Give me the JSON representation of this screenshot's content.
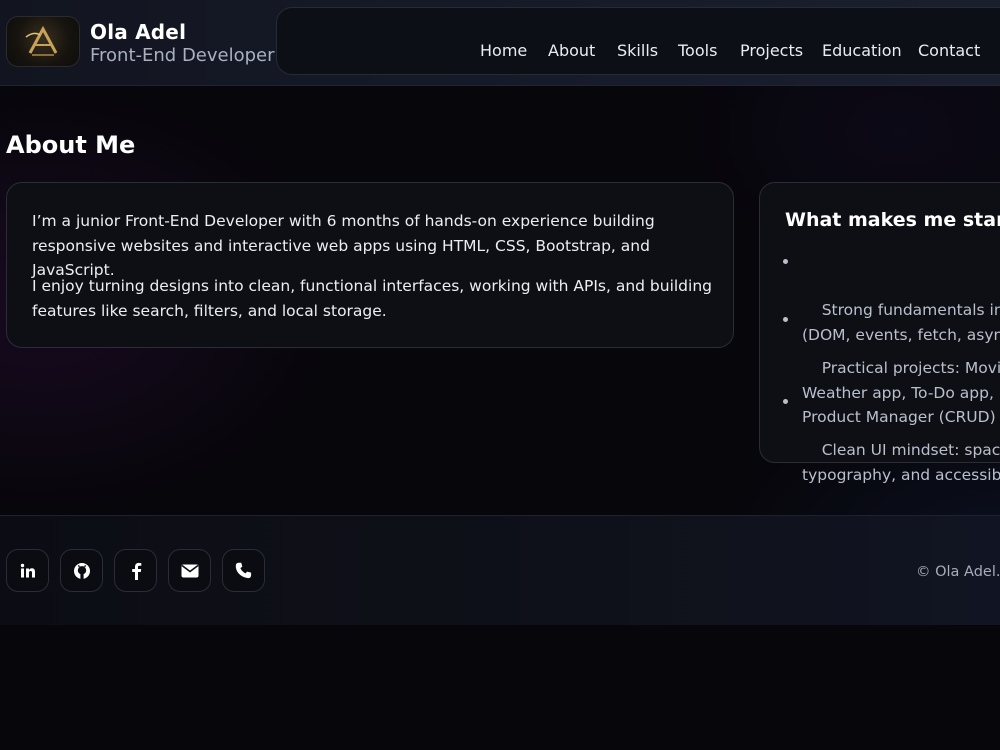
{
  "header": {
    "brand_name": "Ola Adel",
    "brand_role": "Front-End Developer",
    "logo_icon": "gold-monogram-logo"
  },
  "nav": {
    "items": [
      {
        "label": "Home"
      },
      {
        "label": "About"
      },
      {
        "label": "Skills"
      },
      {
        "label": "Tools"
      },
      {
        "label": "Projects"
      },
      {
        "label": "Education"
      },
      {
        "label": "Contact"
      }
    ]
  },
  "about": {
    "title": "About Me",
    "paragraphs": [
      "I’m a junior Front-End Developer with 6 months of hands-on experience building responsive websites and interactive web apps using HTML, CSS, Bootstrap, and JavaScript.",
      "I enjoy turning designs into clean, functional interfaces, working with APIs, and building features like search, filters, and local storage."
    ],
    "highlights": {
      "heading": "What makes me stand",
      "items": [
        "Strong fundamentals in Ja\n(DOM, events, fetch, asyn",
        "Practical projects: Movies\nWeather app, To-Do app,\nProduct Manager (CRUD)",
        "Clean UI mindset: spacing\ntypography, and accessib"
      ]
    }
  },
  "footer": {
    "socials": [
      {
        "icon": "linkedin-icon"
      },
      {
        "icon": "github-icon"
      },
      {
        "icon": "facebook-icon"
      },
      {
        "icon": "envelope-icon"
      },
      {
        "icon": "phone-icon"
      }
    ],
    "copyright": "© Ola Adel. A"
  },
  "colors": {
    "background": "#07060b",
    "header": "#171b29",
    "card": "#0e0f15",
    "text_primary": "#ffffff",
    "text_muted": "#a9b0bf",
    "logo_gold": "#c9a25a"
  }
}
